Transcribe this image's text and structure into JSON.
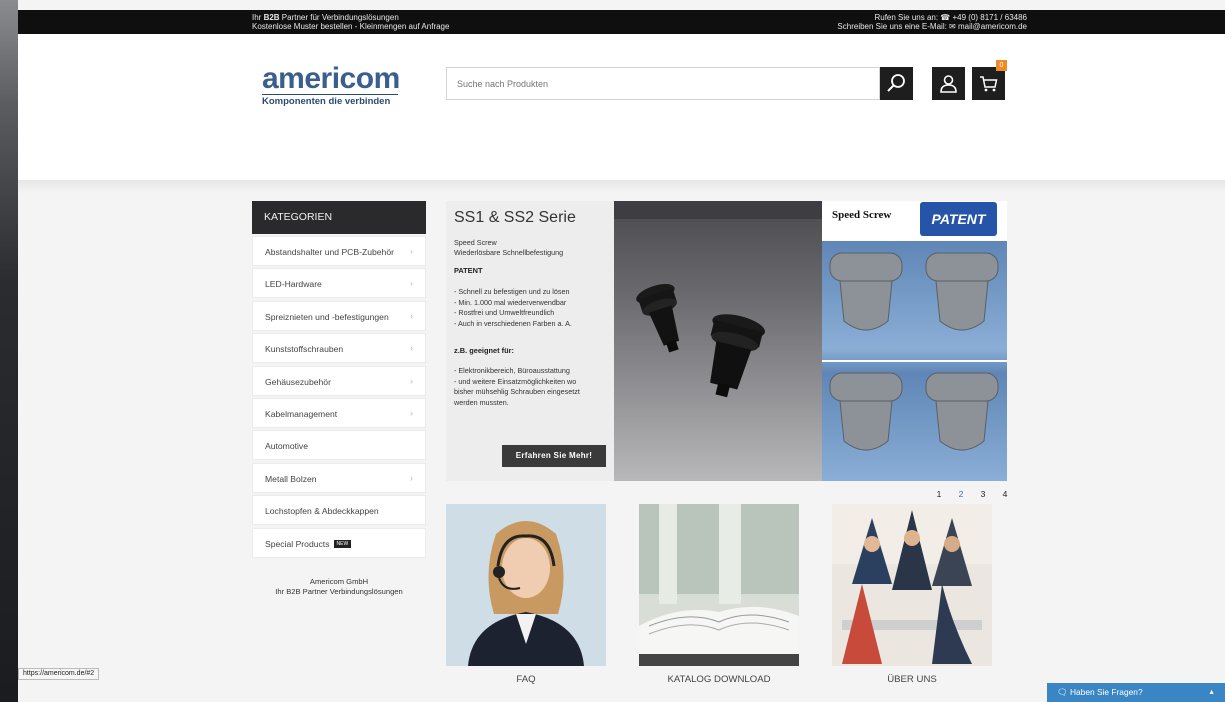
{
  "topbar": {
    "left_line1_prefix": "Ihr ",
    "left_line1_bold": "B2B",
    "left_line1_suffix": " Partner für Verbindungslösungen",
    "left_line2": "Kostenlose Muster bestellen - Kleinmengen auf Anfrage",
    "right_line1": "Rufen Sie uns an: ☎ +49 (0) 8171 / 63486",
    "right_line2": "Schreiben Sie uns eine E-Mail: ✉ mail@americom.de"
  },
  "header": {
    "logo_word": "americom",
    "logo_tagline": "Komponenten die verbinden",
    "search_placeholder": "Suche nach Produkten",
    "cart_count": "0"
  },
  "sidebar": {
    "heading": "KATEGORIEN",
    "items": [
      {
        "label": "Abstandshalter und PCB-Zubehör",
        "chevron": "›"
      },
      {
        "label": "LED-Hardware",
        "chevron": "›"
      },
      {
        "label": "Spreiznieten und -befestigungen",
        "chevron": "›"
      },
      {
        "label": "Kunststoffschrauben",
        "chevron": "›"
      },
      {
        "label": "Gehäusezubehör",
        "chevron": "›"
      },
      {
        "label": "Kabelmanagement",
        "chevron": "›"
      },
      {
        "label": "Automotive",
        "chevron": ""
      },
      {
        "label": "Metall Bolzen",
        "chevron": "›"
      },
      {
        "label": "Lochstopfen & Abdeckkappen",
        "chevron": ""
      },
      {
        "label": "Special Products",
        "chevron": "",
        "badge": "NEW"
      }
    ],
    "company_name": "Americom GmbH",
    "company_tagline": "Ihr B2B Partner Verbindungslösungen"
  },
  "banner": {
    "title": "SS1 & SS2 Serie",
    "subtitle_line1": "Speed Screw",
    "subtitle_line2": "Wiederlösbare Schnellbefestigung",
    "patent_heading": "PATENT",
    "features": [
      "- Schnell zu befestigen und zu lösen",
      "- Min. 1.000 mal wiederverwendbar",
      "- Rostfrei und Umweltfreundlich",
      "- Auch in verschiedenen Farben a. A."
    ],
    "suitable_heading": "z.B. geeignet für:",
    "suitable": [
      "- Elektronikbereich, Büroausstattung",
      "- und weitere Einsatzmöglichkeiten wo",
      "bisher mühsehlig Schrauben eingesetzt",
      "werden mussten."
    ],
    "cta": "Erfahren Sie Mehr!",
    "speed_screw_label": "Speed Screw",
    "patent_badge": "PATENT"
  },
  "pager": {
    "pages": [
      "1",
      "2",
      "3",
      "4"
    ],
    "active_index": 1
  },
  "tiles": [
    {
      "label": "FAQ"
    },
    {
      "label": "KATALOG DOWNLOAD"
    },
    {
      "label": "ÜBER UNS"
    }
  ],
  "status_url": "https://americom.de/#2",
  "chat": {
    "label": "Haben Sie Fragen?",
    "caret": "▲"
  },
  "colors": {
    "brand_blue": "#3a5f8f",
    "patent_blue": "#2654a8",
    "cart_badge": "#f08a24",
    "chat": "#3a86c4"
  }
}
